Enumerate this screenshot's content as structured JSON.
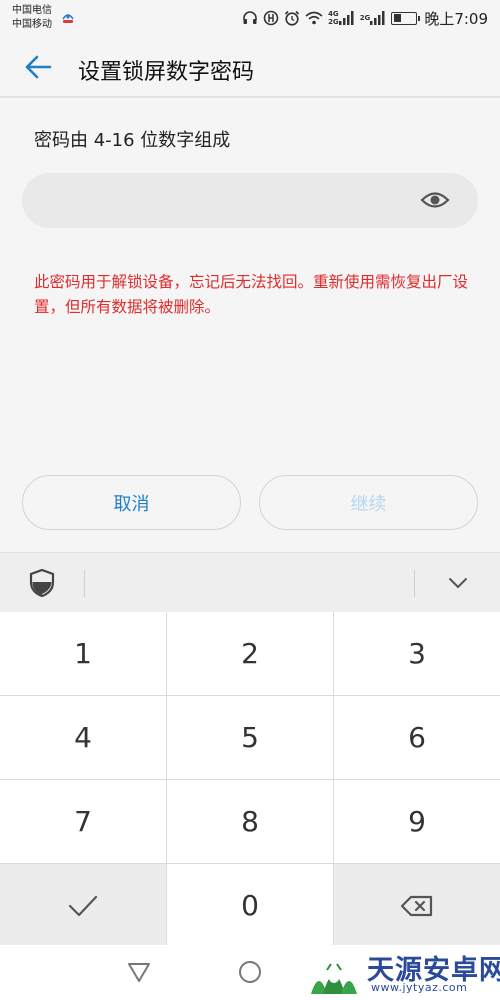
{
  "status_bar": {
    "carrier_1": "中国电信",
    "carrier_2": "中国移动",
    "network_1": "4G\n2G",
    "network_2": "2G",
    "battery_level": 0.35,
    "time": "晚上7:09"
  },
  "header": {
    "title": "设置锁屏数字密码"
  },
  "form": {
    "hint": "密码由 4-16 位数字组成",
    "password_value": "",
    "warning": "此密码用于解锁设备，忘记后无法找回。重新使用需恢复出厂设置，但所有数据将被删除。",
    "cancel_label": "取消",
    "continue_label": "继续"
  },
  "keyboard": {
    "keys": [
      "1",
      "2",
      "3",
      "4",
      "5",
      "6",
      "7",
      "8",
      "9",
      "✓",
      "0",
      "⌫"
    ]
  },
  "watermark": {
    "title": "天源安卓网",
    "url": "www.jytyaz.com"
  },
  "colors": {
    "accent": "#1f7fc6",
    "warning": "#e02c2c",
    "disabled": "#b8d6ee",
    "watermark": "#2b4a9c"
  }
}
